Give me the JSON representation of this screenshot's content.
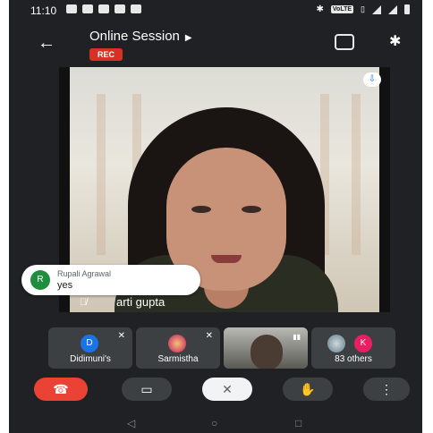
{
  "status_bar": {
    "time": "11:10",
    "lte_label": "VoLTE"
  },
  "header": {
    "title": "Online Session",
    "rec_label": "REC"
  },
  "main_video": {
    "participant_name": "arti gupta"
  },
  "chat_notification": {
    "avatar_initial": "R",
    "sender": "Rupali Agrawal",
    "message": "yes"
  },
  "participants": [
    {
      "initial": "D",
      "name": "Didimuni's",
      "color": "#1a73e8"
    },
    {
      "initial": "",
      "name": "Sarmistha",
      "color": "#c2185b"
    },
    {
      "initial": "",
      "name": "",
      "color": ""
    },
    {
      "initial": "K",
      "name": "83 others",
      "color": "#e91e63"
    }
  ],
  "controls": {
    "end_call_icon": "phone-hangup-icon",
    "camera_icon": "camera-icon",
    "mic_icon": "mic-off-icon",
    "raise_hand_icon": "hand-icon",
    "more_icon": "more-vert-icon"
  },
  "colors": {
    "background": "#202124",
    "rec": "#d93025",
    "end_call": "#ea4335",
    "chat_avatar": "#1e8e3e"
  }
}
